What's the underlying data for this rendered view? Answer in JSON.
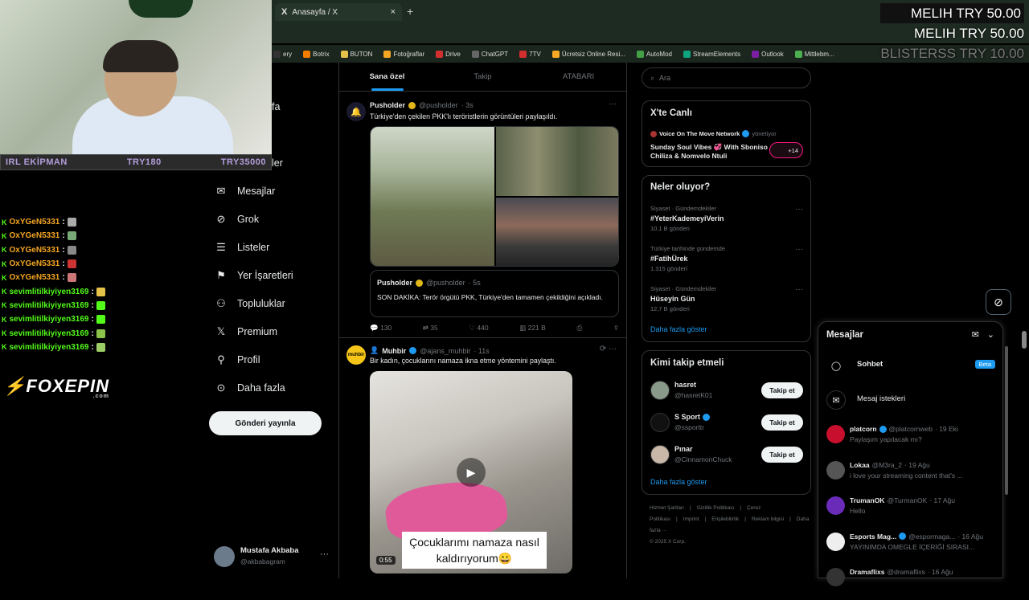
{
  "browser": {
    "tab_title": "Anasayfa / X",
    "tab_icon": "X",
    "new_tab": "+",
    "close": "×",
    "bookmarks": [
      "ery",
      "Botrix",
      "BUTON",
      "Fotoğraflar",
      "Drive",
      "ChatGPT",
      "7TV",
      "Ücretsiz Online Resi...",
      "AutoMod",
      "StreamElements",
      "Outlook",
      "Mittlebm..."
    ]
  },
  "overlay": {
    "donation": [
      "MELIH  TRY 50.00",
      "MELIH  TRY 50.00",
      "BLISTERSS  TRY 10.00"
    ],
    "irl": {
      "label": "IRL EKİPMAN",
      "min": "TRY180",
      "max": "TRY35000"
    },
    "chat": [
      {
        "user": "OxYGeN5331",
        "sep": ":",
        "emote": "#aaa"
      },
      {
        "user": "OxYGeN5331",
        "sep": ":",
        "emote": "#7a7"
      },
      {
        "user": "OxYGeN5331",
        "sep": ":",
        "emote": "#888"
      },
      {
        "user": "OxYGeN5331",
        "sep": ":",
        "emote": "#c33"
      },
      {
        "user": "OxYGeN5331",
        "sep": ":",
        "emote": "#c77"
      },
      {
        "user": "sevimlitilkiyiyen3169",
        "sep": ":",
        "emote": "#e6c24a"
      },
      {
        "user": "sevimlitilkiyiyen3169",
        "sep": ":",
        "emote": "#53fc18"
      },
      {
        "user": "sevimlitilkiyiyen3169",
        "sep": ":",
        "emote": "#53fc18"
      },
      {
        "user": "sevimlitilkiyiyen3169",
        "sep": ":",
        "emote": "#8bc34a"
      },
      {
        "user": "sevimlitilkiyiyen3169",
        "sep": ":",
        "emote": "#9ccc65"
      }
    ],
    "sponsor": {
      "brand": "FOXEPIN",
      "tld": ".com"
    }
  },
  "sidebar": {
    "partial_top": "fa",
    "partial_2": "ler",
    "items": [
      {
        "label": "Mesajlar",
        "icon": "mail-icon"
      },
      {
        "label": "Grok",
        "icon": "grok-icon"
      },
      {
        "label": "Listeler",
        "icon": "list-icon"
      },
      {
        "label": "Yer İşaretleri",
        "icon": "bookmark-icon"
      },
      {
        "label": "Topluluklar",
        "icon": "people-icon"
      },
      {
        "label": "Premium",
        "icon": "x-icon"
      },
      {
        "label": "Profil",
        "icon": "person-icon"
      },
      {
        "label": "Daha fazla",
        "icon": "more-circle-icon"
      }
    ],
    "post_button": "Gönderi yayınla",
    "account": {
      "name": "Mustafa Akbaba",
      "handle": "@akbabagram",
      "more": "···"
    }
  },
  "feed": {
    "tabs": [
      "Sana özel",
      "Takip",
      "ATABARI"
    ],
    "tweet1": {
      "name": "Pusholder",
      "handle": "@pusholder",
      "time": "· 3s",
      "text": "Türkiye'den çekilen PKK'lı teröristlerin görüntüleri paylaşıldı.",
      "quote": {
        "name": "Pusholder",
        "handle": "@pusholder",
        "time": "· 5s",
        "text": "SON DAKİKA: Terör örgütü PKK, Türkiye'den tamamen çekildiğini açıkladı."
      },
      "stats": {
        "replies": "130",
        "retweets": "35",
        "likes": "440",
        "views": "221 B"
      }
    },
    "tweet2": {
      "name": "Muhbir",
      "handle": "@ajans_muhbir",
      "time": "· 11s",
      "text": "Bir kadın, çocuklarını namaza ikna etme yöntemini paylaştı.",
      "caption": "Çocuklarımı namaza nasıl kaldırıyorum😀",
      "duration": "0:55"
    }
  },
  "right": {
    "search_placeholder": "Ara",
    "live": {
      "title": "X'te Canlı",
      "host": "Voice On The Move Network",
      "role": "yönetiyor",
      "space": "Sunday Soul Vibes 💞 With Sboniso Chiliza & Nomvelo Ntuli",
      "count": "+14"
    },
    "trends_title": "Neler oluyor?",
    "trends": [
      {
        "meta": "Siyaset · Gündemdekiler",
        "name": "#YeterKademeyiVerin",
        "count": "10,1 B gönderi"
      },
      {
        "meta": "Türkiye tarihinde gündemde",
        "name": "#FatihÜrek",
        "count": "1.315 gönderi"
      },
      {
        "meta": "Siyaset · Gündemdekiler",
        "name": "Hüseyin Gün",
        "count": "12,7 B gönderi"
      }
    ],
    "show_more": "Daha fazla göster",
    "who_title": "Kimi takip etmeli",
    "who": [
      {
        "name": "hasret",
        "handle": "@hasretK01",
        "button": "Takip et"
      },
      {
        "name": "S Sport",
        "handle": "@ssporttr",
        "button": "Takip et"
      },
      {
        "name": "Pınar",
        "handle": "@CinnamonChuck",
        "button": "Takip et"
      }
    ],
    "footer": [
      "Hizmet Şartları",
      "|",
      "Gizlilik Politikası",
      "|",
      "Çerez Politikası",
      "|",
      "Imprint",
      "|",
      "Erişilebilirlik",
      "|",
      "Reklam bilgisi",
      "|",
      "Daha fazla ···",
      "© 2025 X Corp."
    ]
  },
  "dm": {
    "title": "Mesajlar",
    "chat_label": "Sohbet",
    "beta": "Beta",
    "requests_label": "Mesaj istekleri",
    "conversations": [
      {
        "name": "platcorn",
        "handle": "@platcornweb",
        "time": "· 19 Eki",
        "preview": "Paylaşım yapılacak mı?",
        "color": "#c8102e"
      },
      {
        "name": "Lokaa",
        "handle": "@M3ra_2",
        "time": "· 19 Ağu",
        "preview": "i love your streaming content that's ...",
        "color": "#555"
      },
      {
        "name": "TrumanOK",
        "handle": "@TurmanOK",
        "time": "· 17 Ağu",
        "preview": "Hello",
        "color": "#6a2bb8"
      },
      {
        "name": "Esports Mag...",
        "handle": "@espormaga...",
        "time": "· 16 Ağu",
        "preview": "YAYINIMDA OMEGLE İÇERİĞİ SIRASI...",
        "color": "#eee"
      },
      {
        "name": "Dramaflixs",
        "handle": "@dramaflixs",
        "time": "· 16 Ağu",
        "preview": "",
        "color": "#333"
      }
    ]
  }
}
